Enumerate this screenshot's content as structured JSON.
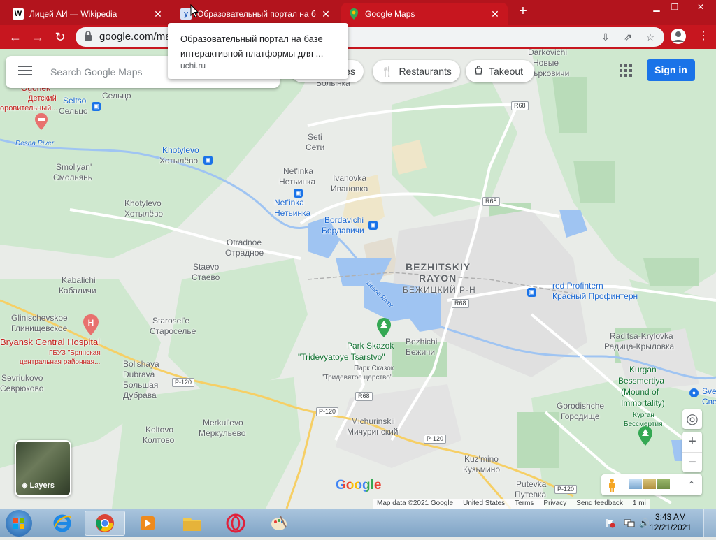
{
  "browser": {
    "tabs": [
      {
        "title": "Лицей АИ — Wikipedia",
        "icon": "wikipedia-icon",
        "active": false
      },
      {
        "title": "Образовательный портал на б",
        "icon": "uchi-icon",
        "active": false
      },
      {
        "title": "Google Maps",
        "icon": "google-maps-icon",
        "active": true
      }
    ],
    "new_tab": "+",
    "url": "google.com/ma",
    "tooltip": {
      "title": "Образовательный портал на базе интерактивной платформы для ...",
      "domain": "uchi.ru"
    }
  },
  "maps": {
    "search_placeholder": "Search Google Maps",
    "chips": [
      {
        "label": "ies",
        "icon": ""
      },
      {
        "label": "Restaurants",
        "icon": "fork-knife-icon"
      },
      {
        "label": "Takeout",
        "icon": "takeout-icon"
      }
    ],
    "sign_in": "Sign in",
    "layers_label": "Layers",
    "google_logo": "Google",
    "attribution": {
      "map_data": "Map data ©2021 Google",
      "country": "United States",
      "terms": "Terms",
      "privacy": "Privacy",
      "feedback": "Send feedback",
      "scale": "1 mi"
    },
    "labels": {
      "ogonek": "Ogonek",
      "detskiy": "Детский",
      "ozdorov": "оровительный...",
      "seltso_ru_top": "Сельцо",
      "seltso_en": "Seltso",
      "seltso_ru": "Сельцо",
      "desna_river_w": "Desna River",
      "smolyan_en": "Smol'yan'",
      "smolyan_ru": "Смольянь",
      "khotylevo_en": "Khotylevo",
      "khotylevo_ru": "Хотылёво",
      "khotylevo2_en": "Khotylevo",
      "khotylevo2_ru": "Хотылёво",
      "seti_en": "Seti",
      "seti_ru": "Сети",
      "netinka_en": "Net'inka",
      "netinka_ru": "Нетьинка",
      "netinka2_en": "Net'inka",
      "netinka2_ru": "Нетьинка",
      "ivanovka_en": "Ivanovka",
      "ivanovka_ru": "Ивановка",
      "bordavichi_en": "Bordavichi",
      "bordavichi_ru": "Бордавичи",
      "volynka": "Волынка",
      "otradnoe_en": "Otradnoe",
      "otradnoe_ru": "Отрадное",
      "darkovichi": "Darkovichi",
      "novye": "Новые",
      "rkovichi": "ърковичи",
      "bezhitskiy1": "BEZHITSKIY",
      "bezhitskiy2": "RAYON",
      "bezhitskiy_ru": "БЕЖИЦКИЙ Р-Н",
      "staevo_en": "Staevo",
      "staevo_ru": "Стаево",
      "kabalichi_en": "Kabalichi",
      "kabalichi_ru": "Кабаличи",
      "glini_en": "Glinischevskoe",
      "glini_ru": "Глинищевское",
      "hospital_en": "Bryansk Central Hospital",
      "hospital_ru1": "ГБУЗ \"Брянская",
      "hospital_ru2": "центральная районная...",
      "starosele_en": "Starosel'e",
      "starosele_ru": "Староселье",
      "desna_river": "Desna River",
      "park_en1": "Park Skazok",
      "park_en2": "\"Tridevyatoye Tsarstvo\"",
      "park_ru1": "Парк Сказок",
      "park_ru2": "\"Тридевятое царство\"",
      "bezhichi_en": "Bezhichi",
      "bezhichi_ru": "Бежичи",
      "profintern_en": "red Profintern",
      "profintern_ru": "Красный Профинтерн",
      "raditsa_en": "Raditsa-Krylovka",
      "raditsa_ru": "Радица-Крыловка",
      "kurgan_en1": "Kurgan",
      "kurgan_en2": "Bessmertiya",
      "kurgan_en3": "(Mound of",
      "kurgan_en4": "Immortality)",
      "kurgan_ru1": "Курган",
      "kurgan_ru2": "Бессмертия",
      "sve1": "Sve",
      "sve2": "Све",
      "sevriukovo_en": "Sevriukovo",
      "sevriukovo_ru": "Севрюково",
      "bolshaya_en": "Bol'shaya",
      "bolshaya_en2": "Dubrava",
      "bolshaya_ru": "Большая",
      "bolshaya_ru2": "Дубрава",
      "koltovo_en": "Koltovo",
      "koltovo_ru": "Колтово",
      "merkulevo_en": "Merkul'evo",
      "merkulevo_ru": "Меркульево",
      "michurinskii_en": "Michurinskii",
      "michurinskii_ru": "Мичуринский",
      "gorodishche_en": "Gorodishche",
      "gorodishche_ru": "Городище",
      "kuzmino_en": "Kuz'mino",
      "kuzmino_ru": "Кузьмино",
      "putevka_en": "Putevka",
      "putevka_ru": "Путевка"
    },
    "road_shields": [
      "R68",
      "R68",
      "R68",
      "R68",
      "P-120",
      "P-120",
      "P-120",
      "P-120"
    ]
  },
  "taskbar": {
    "time": "3:43 AM",
    "date": "12/21/2021"
  },
  "colors": {
    "chrome_red": "#c7161f",
    "map_green": "#c8e6c9",
    "water": "#9fc4f2",
    "accent_blue": "#1a73e8"
  }
}
